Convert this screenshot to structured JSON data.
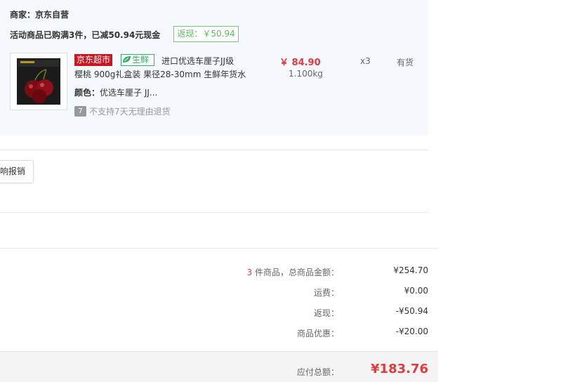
{
  "store": {
    "merchant": "商家：京东自营",
    "promo_text": "活动商品已购满3件，已减50.94元现金",
    "cashback_tag": "返现：￥50.94"
  },
  "product": {
    "image_icon": "cherry-gift-box-image",
    "tag_jd": "京东超市",
    "tag_fresh": "生鲜",
    "title_line1": "进口优选车厘子JJ级",
    "title_line2": "樱桃 900g礼盒装 果径28-30mm 生鲜年货水",
    "color_label": "颜色：",
    "color_value": "优选车厘子 JJ...",
    "no_return_icon": "7",
    "no_return_text": "不支持7天无理由退货",
    "price": "￥ 84.90",
    "weight": "1.100kg",
    "quantity": "x3",
    "stock": "有货"
  },
  "reimburse_button": "响报销",
  "summary": {
    "item_count": "3",
    "items_label": " 件商品，总商品金额：",
    "items_total": "¥254.70",
    "shipping_label": "运费：",
    "shipping_value": "¥0.00",
    "cashback_label": "返现：",
    "cashback_value": "-¥50.94",
    "discount_label": "商品优惠：",
    "discount_value": "-¥20.00",
    "total_label": "应付总额：",
    "total_value": "¥183.76"
  },
  "colors": {
    "accent_red": "#e4393c",
    "jd_red": "#c81623",
    "fresh_green": "#2fb066",
    "panel_bg": "#f3f9fd"
  }
}
